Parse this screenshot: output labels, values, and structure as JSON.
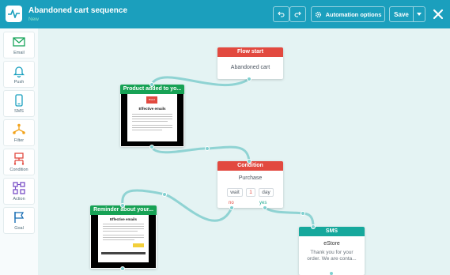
{
  "header": {
    "title": "Abandoned cart sequence",
    "status": "New",
    "automation_options_label": "Automation options",
    "save_label": "Save"
  },
  "sidebar": {
    "items": [
      {
        "label": "Email",
        "icon": "envelope-icon"
      },
      {
        "label": "Push",
        "icon": "bell-icon"
      },
      {
        "label": "SMS",
        "icon": "phone-icon"
      },
      {
        "label": "Filter",
        "icon": "filter-icon"
      },
      {
        "label": "Condition",
        "icon": "condition-icon"
      },
      {
        "label": "Action",
        "icon": "action-icon"
      },
      {
        "label": "Goal",
        "icon": "flag-icon"
      }
    ]
  },
  "nodes": {
    "flow_start": {
      "header": "Flow start",
      "body": "Abandoned cart"
    },
    "product_added": {
      "header": "Product added to yo...",
      "preview_title": "Effective emails",
      "brand_text": "Brand"
    },
    "condition": {
      "header": "Condition",
      "body": "Purchase",
      "wait_label": "wait",
      "wait_value": "1",
      "wait_unit": "day",
      "no_label": "no",
      "yes_label": "yes"
    },
    "reminder": {
      "header": "Reminder about your...",
      "preview_title": "Effective emails"
    },
    "sms": {
      "header": "SMS",
      "sender": "eStore",
      "message": "Thank you for your order. We are conta..."
    }
  },
  "colors": {
    "topbar": "#1b9fbd",
    "canvas": "#e4f3f3",
    "start_header": "#e2493f",
    "condition_header": "#e2493f",
    "email_header": "#17a255",
    "sms_header": "#16a89c",
    "wire": "#8fd3d3"
  }
}
